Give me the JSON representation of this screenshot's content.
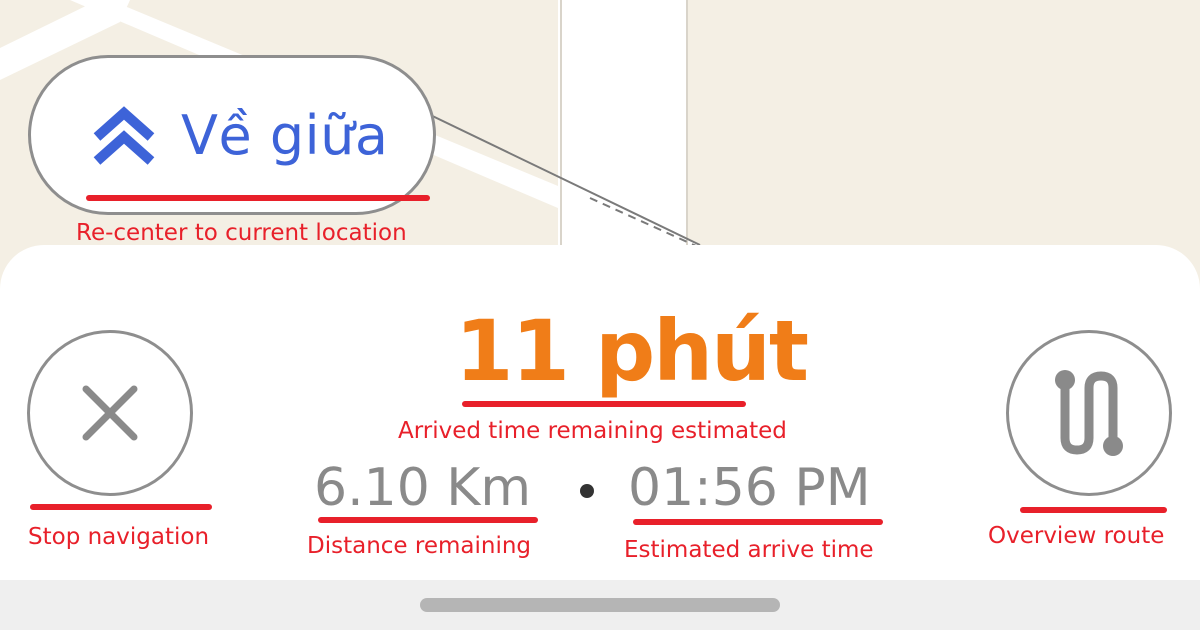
{
  "map": {
    "recenter_label": "Về giữa",
    "recenter_icon": "double-chevron-up-icon",
    "colors": {
      "map_bg": "#f4efe4",
      "road": "#ffffff",
      "accent_blue": "#3d63d8"
    }
  },
  "navigation": {
    "eta_remaining": "11 phút",
    "distance_remaining": "6.10 Km",
    "arrival_time": "01:56 PM",
    "stop_icon": "close-icon",
    "overview_icon": "route-overview-icon",
    "colors": {
      "eta": "#f07d18",
      "stats": "#8a8a8a"
    }
  },
  "annotations": {
    "recenter": "Re-center to current location",
    "eta": "Arrived time remaining estimated",
    "stop": "Stop navigation",
    "distance": "Distance remaining",
    "arrival": "Estimated arrive time",
    "overview": "Overview route",
    "color": "#e8202a"
  }
}
